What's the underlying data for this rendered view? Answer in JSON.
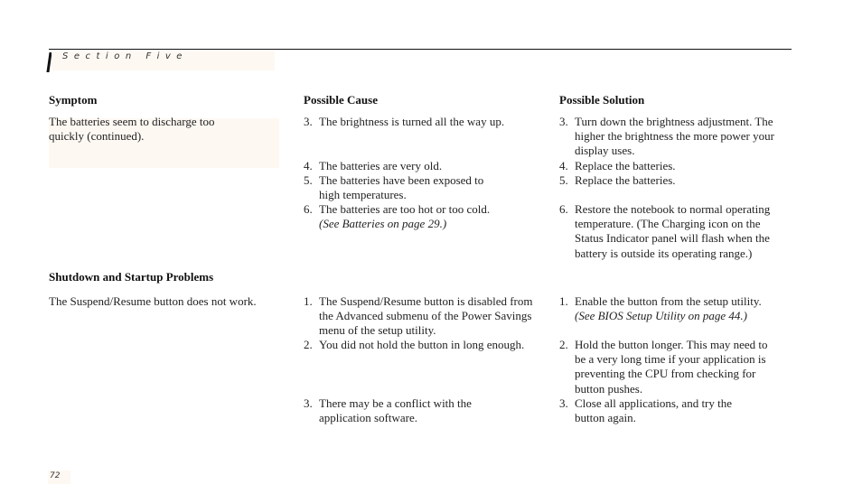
{
  "header": {
    "section_label": "Section Five"
  },
  "columns": {
    "symptom": "Symptom",
    "cause": "Possible Cause",
    "solution": "Possible Solution"
  },
  "battery": {
    "symptom_line1": "The batteries seem to discharge too",
    "symptom_line2": "quickly (continued).",
    "causes": [
      {
        "num": "3.",
        "lines": [
          "The brightness is turned all the way up."
        ]
      },
      {
        "num": "4.",
        "lines": [
          "The batteries are very old."
        ]
      },
      {
        "num": "5.",
        "lines": [
          "The batteries have been exposed to",
          "high temperatures."
        ]
      },
      {
        "num": "6.",
        "lines": [
          "The batteries are too hot or too cold."
        ],
        "ref": "(See Batteries on page 29.)"
      }
    ],
    "solutions": [
      {
        "num": "3.",
        "lines": [
          "Turn down the brightness adjustment. The",
          "higher the brightness the more power your",
          "display uses."
        ]
      },
      {
        "num": "4.",
        "lines": [
          "Replace the batteries."
        ]
      },
      {
        "num": "5.",
        "lines": [
          "Replace the batteries."
        ]
      },
      {
        "num": "6.",
        "lines": [
          "Restore the notebook to normal operating",
          "temperature. (The Charging icon on the",
          "Status Indicator panel will flash when the",
          "battery is outside its operating range.)"
        ]
      }
    ]
  },
  "shutdown": {
    "title": "Shutdown and Startup Problems",
    "symptom": "The Suspend/Resume button does not work.",
    "causes": [
      {
        "num": "1.",
        "lines": [
          "The Suspend/Resume button is disabled from",
          "the Advanced submenu of the Power Savings",
          "menu of the setup utility."
        ]
      },
      {
        "num": "2.",
        "lines": [
          "You did not hold the button in long enough."
        ]
      },
      {
        "num": "3.",
        "lines": [
          "There may be a conflict with the",
          "application software."
        ]
      }
    ],
    "solutions": [
      {
        "num": "1.",
        "lines": [
          "Enable the button from the setup utility."
        ],
        "ref": "(See BIOS Setup Utility on page 44.)"
      },
      {
        "num": "2.",
        "lines": [
          "Hold the button longer. This may need to",
          "be a very long time if your application is",
          "preventing the CPU from checking for",
          "button pushes."
        ]
      },
      {
        "num": "3.",
        "lines": [
          "Close all applications, and try the",
          "button again."
        ]
      }
    ]
  },
  "footer": {
    "page_number": "72"
  }
}
